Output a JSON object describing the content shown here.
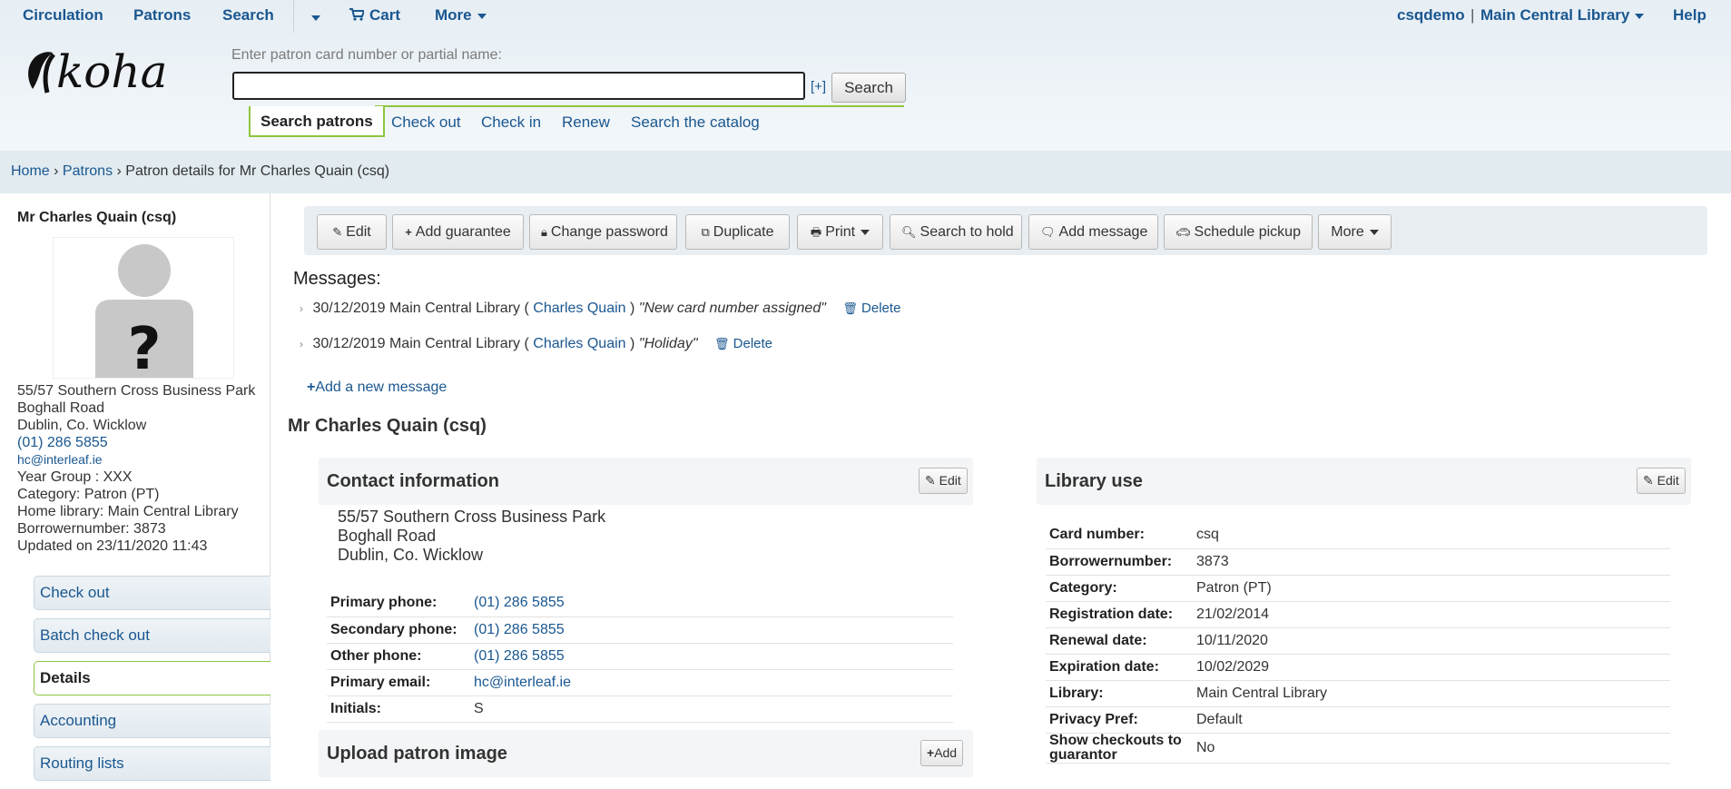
{
  "topnav": {
    "circulation": "Circulation",
    "patrons": "Patrons",
    "search": "Search",
    "cart": "Cart",
    "more": "More",
    "user": "csqdemo",
    "divider": "|",
    "library": "Main Central Library",
    "help": "Help"
  },
  "logo_text": "koha",
  "patron_search": {
    "label": "Enter patron card number or partial name:",
    "value": "",
    "plus": "[+]",
    "button": "Search"
  },
  "subtabs": [
    "Search patrons",
    "Check out",
    "Check in",
    "Renew",
    "Search the catalog"
  ],
  "breadcrumb": {
    "home": "Home",
    "sep": "›",
    "patrons": "Patrons",
    "current": "Patron details for Mr Charles Quain (csq)"
  },
  "sidebar": {
    "name": "Mr Charles Quain (csq)",
    "avatar_mark": "?",
    "address1": "55/57 Southern Cross Business Park",
    "address2": "Boghall Road",
    "address3": "Dublin, Co. Wicklow",
    "phone": "(01) 286 5855",
    "email": "hc@interleaf.ie",
    "year_group": "Year Group : XXX",
    "category": "Category: Patron (PT)",
    "home_library": "Home library: Main Central Library",
    "borrowernumber": "Borrowernumber: 3873",
    "updated": "Updated on 23/11/2020 11:43",
    "menu": [
      "Check out",
      "Batch check out",
      "Details",
      "Accounting",
      "Routing lists"
    ]
  },
  "toolbar": {
    "edit": "Edit",
    "add_guarantee": "Add guarantee",
    "change_password": "Change password",
    "duplicate": "Duplicate",
    "print": "Print",
    "search_to_hold": "Search to hold",
    "add_message": "Add message",
    "schedule_pickup": "Schedule pickup",
    "more": "More"
  },
  "messages": {
    "title": "Messages:",
    "items": [
      {
        "date_lib": "30/12/2019 Main Central Library (",
        "author": "Charles Quain",
        "close": ")",
        "text": "\"New card number assigned\"",
        "delete": "Delete"
      },
      {
        "date_lib": "30/12/2019 Main Central Library (",
        "author": "Charles Quain",
        "close": ")",
        "text": "\"Holiday\"",
        "delete": "Delete"
      }
    ],
    "add_new": "Add a new message"
  },
  "patron_heading": "Mr Charles Quain (csq)",
  "contact": {
    "title": "Contact information",
    "edit": "Edit",
    "address1": "55/57 Southern Cross Business Park",
    "address2": "Boghall Road",
    "address3": "Dublin, Co. Wicklow",
    "rows": [
      {
        "k": "Primary phone:",
        "v": "(01) 286 5855"
      },
      {
        "k": "Secondary phone:",
        "v": "(01) 286 5855"
      },
      {
        "k": "Other phone:",
        "v": "(01) 286 5855"
      },
      {
        "k": "Primary email:",
        "v": "hc@interleaf.ie"
      },
      {
        "k": "Initials:",
        "v": "S"
      }
    ]
  },
  "upload": {
    "title": "Upload patron image",
    "add": "Add"
  },
  "library_use": {
    "title": "Library use",
    "edit": "Edit",
    "rows": [
      {
        "k": "Card number:",
        "v": "csq"
      },
      {
        "k": "Borrowernumber:",
        "v": "3873"
      },
      {
        "k": "Category:",
        "v": "Patron (PT)"
      },
      {
        "k": "Registration date:",
        "v": "21/02/2014"
      },
      {
        "k": "Renewal date:",
        "v": "10/11/2020"
      },
      {
        "k": "Expiration date:",
        "v": "10/02/2029"
      },
      {
        "k": "Library:",
        "v": "Main Central Library"
      },
      {
        "k": "Privacy Pref:",
        "v": "Default"
      },
      {
        "k": "Show checkouts to guarantor",
        "v": "No"
      }
    ]
  },
  "colors": {
    "link": "#1a5790",
    "accent_green": "#8dc63f",
    "breadcrumb_bg": "#e1ebf0"
  }
}
